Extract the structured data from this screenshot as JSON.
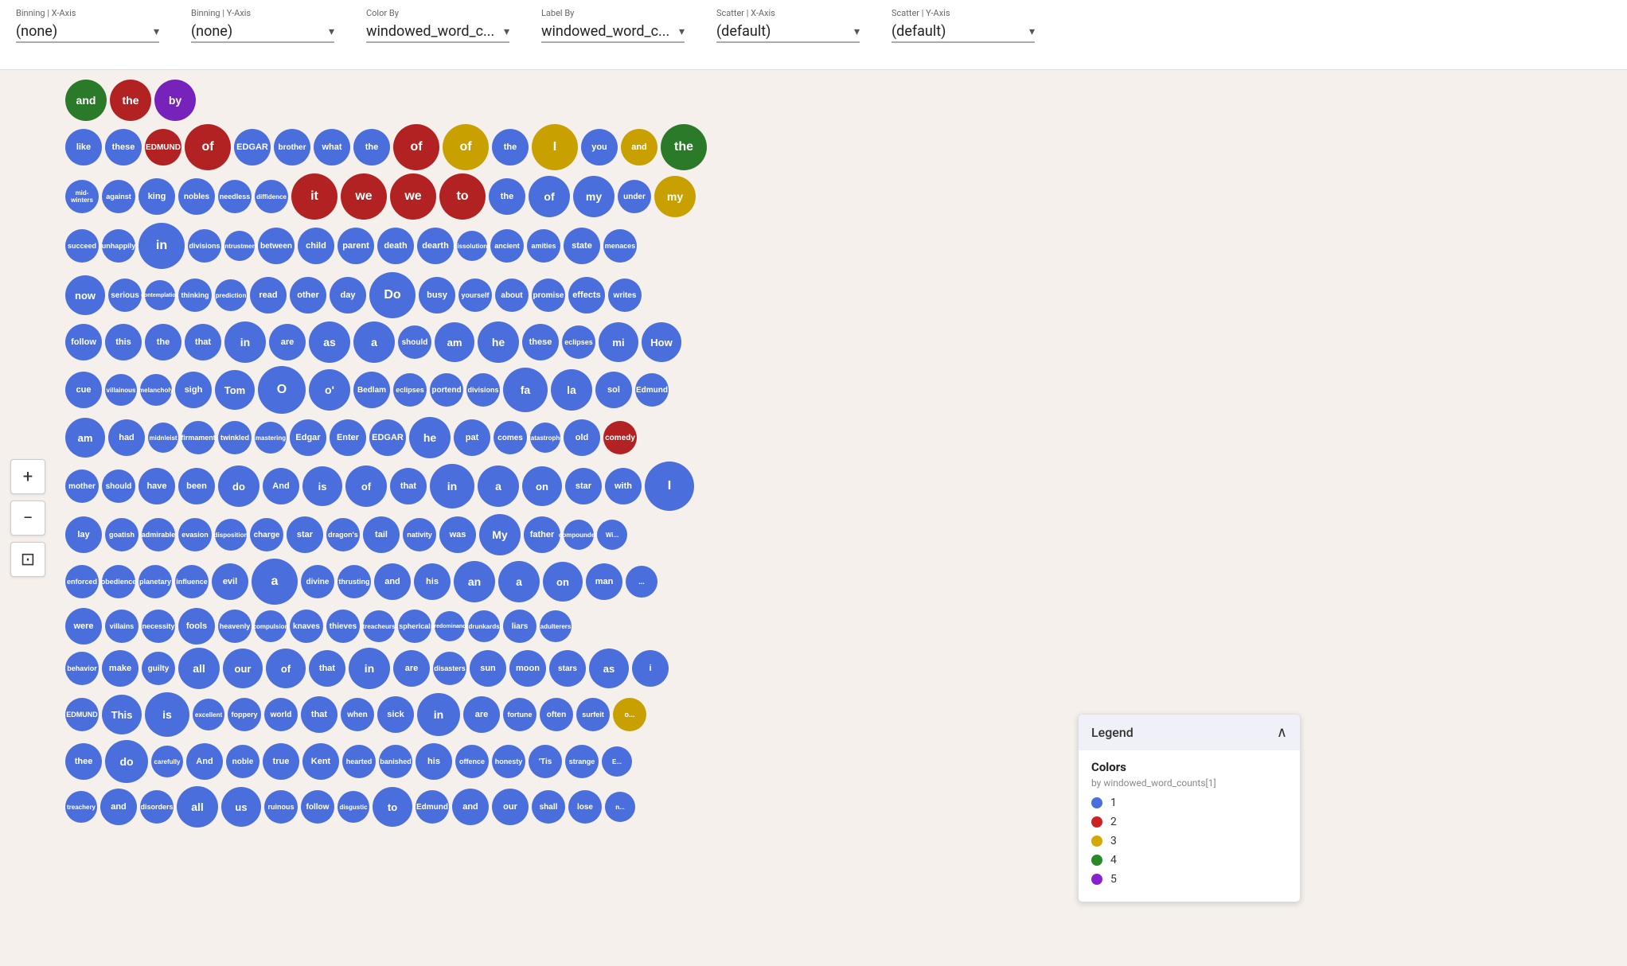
{
  "controls": {
    "binning_x": {
      "label": "Binning | X-Axis",
      "value": "(none)"
    },
    "binning_y": {
      "label": "Binning | Y-Axis",
      "value": "(none)"
    },
    "color_by": {
      "label": "Color By",
      "value": "windowed_word_c..."
    },
    "label_by": {
      "label": "Label By",
      "value": "windowed_word_c..."
    },
    "scatter_x": {
      "label": "Scatter | X-Axis",
      "value": "(default)"
    },
    "scatter_y": {
      "label": "Scatter | Y-Axis",
      "value": "(default)"
    }
  },
  "legend": {
    "title": "Legend",
    "section": "Colors",
    "subtitle": "by windowed_word_counts[1]",
    "items": [
      {
        "label": "1",
        "color": "#4a6fdc"
      },
      {
        "label": "2",
        "color": "#cc2222"
      },
      {
        "label": "3",
        "color": "#d4a800"
      },
      {
        "label": "4",
        "color": "#2a8a2a"
      },
      {
        "label": "5",
        "color": "#8822cc"
      }
    ]
  },
  "zoom": {
    "plus": "+",
    "minus": "−",
    "fit": "⊡"
  }
}
